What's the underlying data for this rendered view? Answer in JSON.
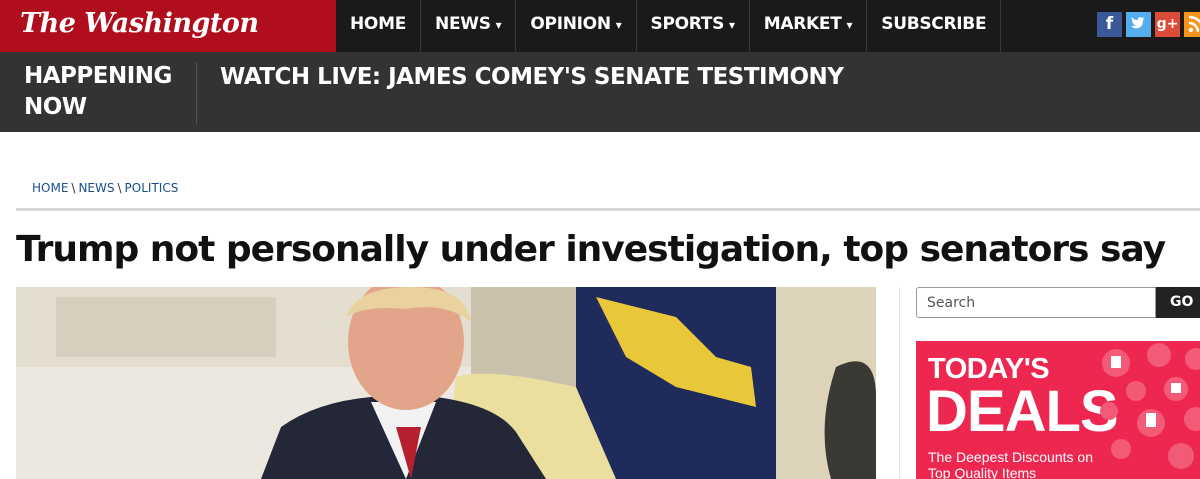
{
  "site": {
    "logo_text": "The Washington Times"
  },
  "nav": {
    "items": [
      {
        "label": "HOME",
        "dropdown": false
      },
      {
        "label": "NEWS",
        "dropdown": true
      },
      {
        "label": "OPINION",
        "dropdown": true
      },
      {
        "label": "SPORTS",
        "dropdown": true
      },
      {
        "label": "MARKET",
        "dropdown": true
      },
      {
        "label": "SUBSCRIBE",
        "dropdown": false
      }
    ],
    "caret": "▾"
  },
  "social": [
    {
      "icon": "facebook-icon",
      "glyph": "f",
      "color": "#3b5998"
    },
    {
      "icon": "twitter-icon",
      "glyph": "t",
      "color": "#55acee"
    },
    {
      "icon": "google-plus-icon",
      "glyph": "g+",
      "color": "#dd4b39"
    },
    {
      "icon": "rss-icon",
      "glyph": "",
      "color": "#f7941d"
    }
  ],
  "happening": {
    "label": "HAPPENING NOW",
    "headline": "WATCH LIVE: JAMES COMEY'S SENATE TESTIMONY"
  },
  "breadcrumb": [
    "HOME",
    "NEWS",
    "POLITICS"
  ],
  "article": {
    "title": "Trump not personally under investigation, top senators say"
  },
  "search": {
    "placeholder": "Search",
    "button_label": "GO"
  },
  "ad": {
    "title_line1": "TODAY'S",
    "title_line2": "DEALS",
    "subtitle": "The Deepest Discounts on Top Quality Items"
  },
  "colors": {
    "brand_red": "#b00d1d",
    "nav_bg": "#1a1a1a",
    "happening_bg": "#333333",
    "ad_pink": "#ee2750",
    "link_blue": "#1a4f8a"
  }
}
